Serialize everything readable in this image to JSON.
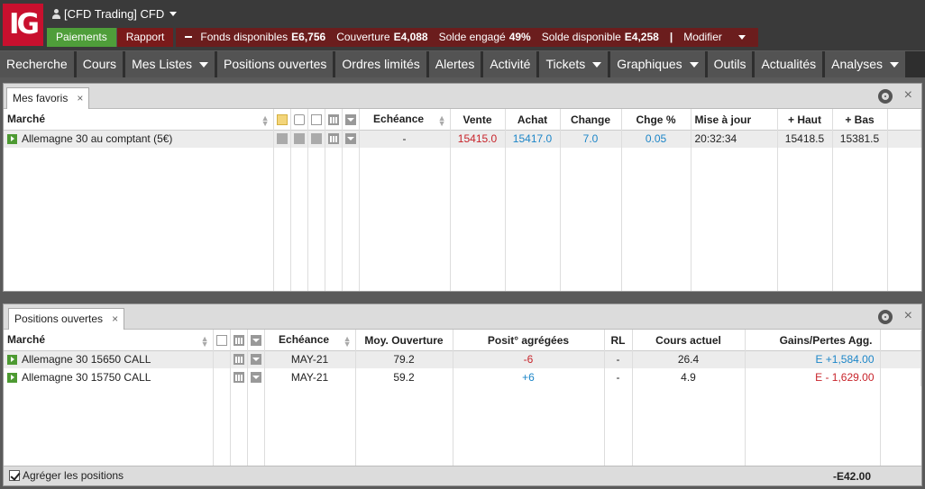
{
  "header": {
    "logo": "IG",
    "account": "[CFD Trading] CFD",
    "payments": "Paiements",
    "report": "Rapport",
    "funds_label": "Fonds disponibles",
    "funds_value": "E6,756",
    "cover_label": "Couverture",
    "cover_value": "E4,088",
    "engaged_label": "Solde engagé",
    "engaged_value": "49%",
    "available_label": "Solde disponible",
    "available_value": "E4,258",
    "separator": "|",
    "modify": "Modifier"
  },
  "nav": {
    "items": [
      {
        "label": "Recherche",
        "dropdown": false
      },
      {
        "label": "Cours",
        "dropdown": false
      },
      {
        "label": "Mes Listes",
        "dropdown": true
      },
      {
        "label": "Positions ouvertes",
        "dropdown": false
      },
      {
        "label": "Ordres limités",
        "dropdown": false
      },
      {
        "label": "Alertes",
        "dropdown": false
      },
      {
        "label": "Activité",
        "dropdown": false
      },
      {
        "label": "Tickets",
        "dropdown": true
      },
      {
        "label": "Graphiques",
        "dropdown": true
      },
      {
        "label": "Outils",
        "dropdown": false
      },
      {
        "label": "Actualités",
        "dropdown": false
      },
      {
        "label": "Analyses",
        "dropdown": true
      }
    ]
  },
  "favorites": {
    "tab": "Mes favoris",
    "close": "×",
    "columns": {
      "market": "Marché",
      "expiry": "Echéance",
      "sell": "Vente",
      "buy": "Achat",
      "change": "Change",
      "change_pct": "Chge %",
      "updated": "Mise à jour",
      "high": "+ Haut",
      "low": "+ Bas"
    },
    "rows": [
      {
        "market": "Allemagne 30 au comptant (5€)",
        "expiry": "-",
        "sell": "15415.0",
        "buy": "15417.0",
        "change": "7.0",
        "change_pct": "0.05",
        "updated": "20:32:34",
        "high": "15418.5",
        "low": "15381.5"
      }
    ]
  },
  "positions": {
    "tab": "Positions ouvertes",
    "close": "×",
    "columns": {
      "market": "Marché",
      "expiry": "Echéance",
      "avg_open": "Moy. Ouverture",
      "aggregated": "Posit° agrégées",
      "rl": "RL",
      "current": "Cours actuel",
      "pl": "Gains/Pertes Agg."
    },
    "rows": [
      {
        "market": "Allemagne 30 15650 CALL",
        "expiry": "MAY-21",
        "avg_open": "79.2",
        "aggregated": "-6",
        "rl": "-",
        "current": "26.4",
        "pl": "E +1,584.00"
      },
      {
        "market": "Allemagne 30 15750 CALL",
        "expiry": "MAY-21",
        "avg_open": "59.2",
        "aggregated": "+6",
        "rl": "-",
        "current": "4.9",
        "pl": "E - 1,629.00"
      }
    ],
    "aggregate_label": "Agréger les positions",
    "aggregate_checked": true,
    "total": "-E42.00"
  },
  "colors": {
    "accent_red": "#c8102e",
    "green": "#4f9e3a",
    "sell_red": "#c8242b",
    "buy_blue": "#1d86c8"
  }
}
